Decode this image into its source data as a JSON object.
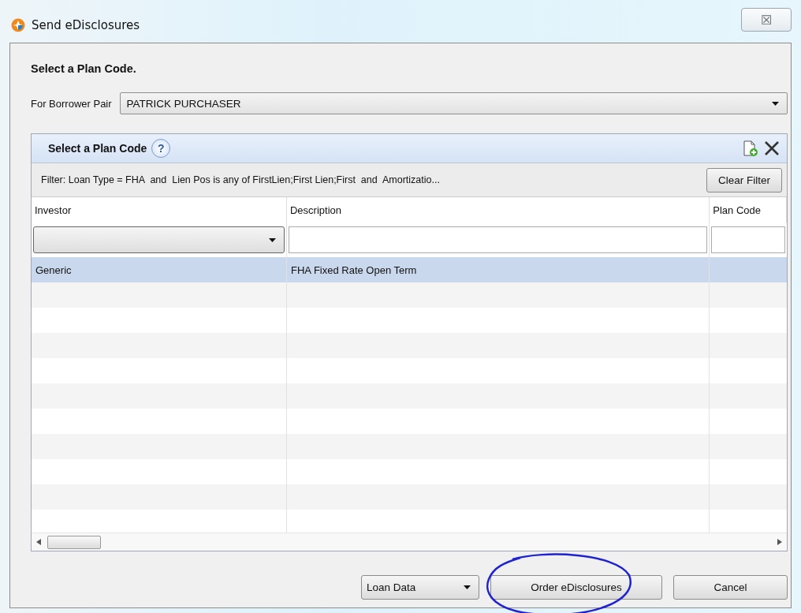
{
  "window": {
    "title": "Send eDisclosures",
    "close_label": "☒"
  },
  "heading": "Select a Plan Code.",
  "borrower": {
    "label": "For Borrower Pair",
    "value": "PATRICK PURCHASER"
  },
  "panel": {
    "title": "Select a Plan Code",
    "help": "?",
    "filter_text": "Filter: Loan Type = FHA  and  Lien Pos is any of FirstLien;First Lien;First  and  Amortizatio...",
    "clear_button": "Clear Filter"
  },
  "table": {
    "columns": [
      "Investor",
      "Description",
      "Plan Code"
    ],
    "rows": [
      {
        "cells": [
          "Generic",
          "FHA Fixed Rate Open Term",
          ""
        ],
        "selected": true
      }
    ]
  },
  "buttons": [
    {
      "kind": "dropdown",
      "label": "Loan Data",
      "circled": false
    },
    {
      "kind": "button",
      "label": "Order eDisclosures",
      "circled": true
    },
    {
      "kind": "button",
      "label": "Cancel",
      "circled": false
    }
  ]
}
